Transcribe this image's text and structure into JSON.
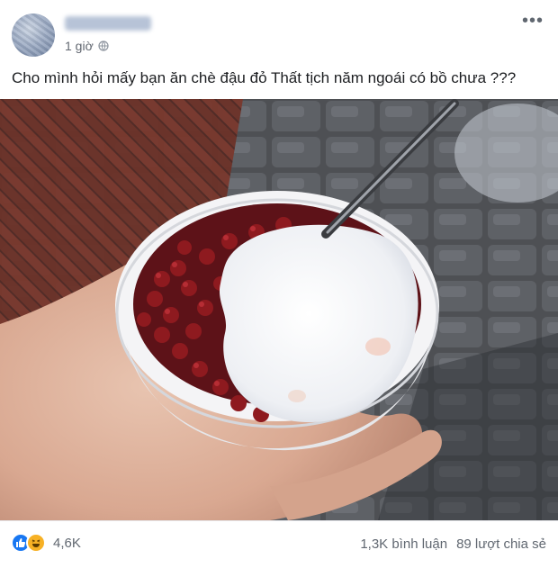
{
  "post": {
    "time": "1 giờ",
    "caption": "Cho mình hỏi mấy bạn ăn chè đậu đỏ Thất tịch năm ngoái có bồ chưa ???"
  },
  "reactions": {
    "icons": [
      "like-icon",
      "haha-icon"
    ],
    "count": "4,6K"
  },
  "stats": {
    "comments": "1,3K bình luận",
    "shares": "89 lượt chia sẻ"
  },
  "colors": {
    "like": "#1877f2",
    "haha": "#f7b125",
    "muted_text": "#606770"
  }
}
